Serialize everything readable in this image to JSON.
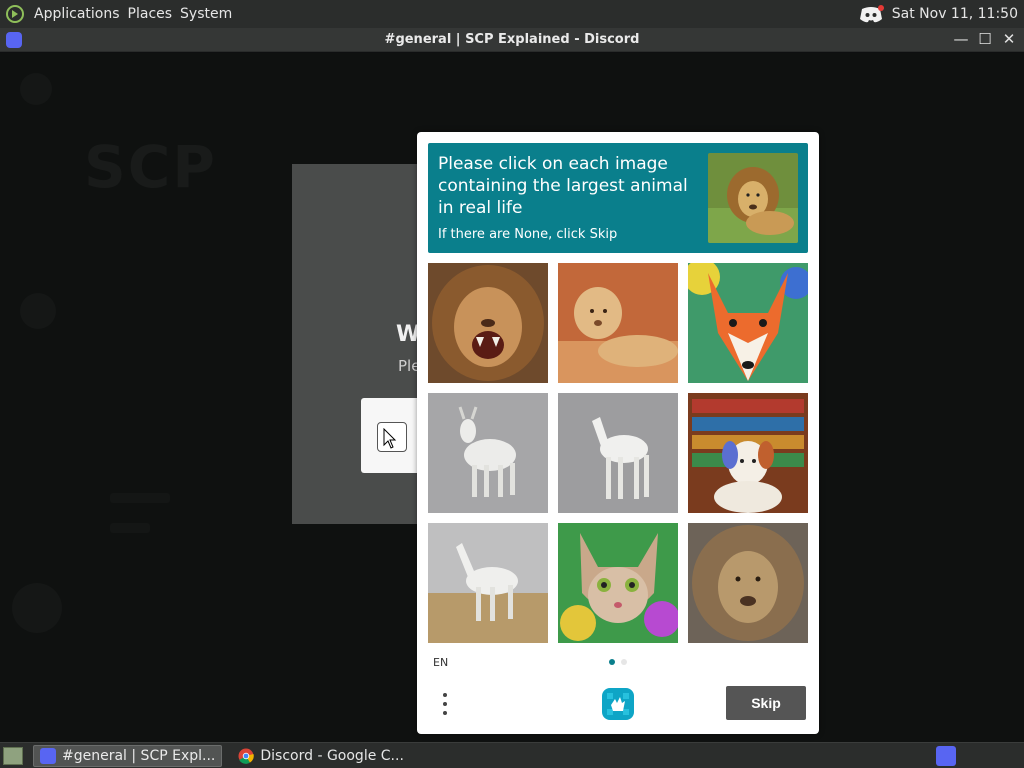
{
  "top_panel": {
    "menus": [
      "Applications",
      "Places",
      "System"
    ],
    "clock": "Sat Nov 11, 11:50"
  },
  "window": {
    "title": "#general | SCP Explained - Discord"
  },
  "background": {
    "server_logo": "SCP",
    "modal_heading_partial": "W",
    "modal_sub_partial": "Ple"
  },
  "captcha": {
    "prompt": "Please click on each image containing the largest animal in real life",
    "sub": "If there are None, click Skip",
    "reference_image": "lion",
    "tiles": [
      {
        "subject": "roaring lion"
      },
      {
        "subject": "lioness lying"
      },
      {
        "subject": "painted fox"
      },
      {
        "subject": "white goat 3d"
      },
      {
        "subject": "white goat-camel 3d"
      },
      {
        "subject": "dog in library"
      },
      {
        "subject": "white goat on sand"
      },
      {
        "subject": "painted cat"
      },
      {
        "subject": "lion face"
      }
    ],
    "language": "EN",
    "skip_label": "Skip",
    "pager": {
      "current": 1,
      "total": 2
    }
  },
  "taskbar": {
    "tasks": [
      {
        "label": "#general | SCP Expl...",
        "icon": "discord-icon",
        "active": true
      },
      {
        "label": "Discord - Google C...",
        "icon": "chrome-icon",
        "active": false
      }
    ]
  },
  "colors": {
    "accent": "#0a7f8c",
    "skip_button": "#555555",
    "panel": "#2b2d2c",
    "discord": "#5865f2"
  }
}
